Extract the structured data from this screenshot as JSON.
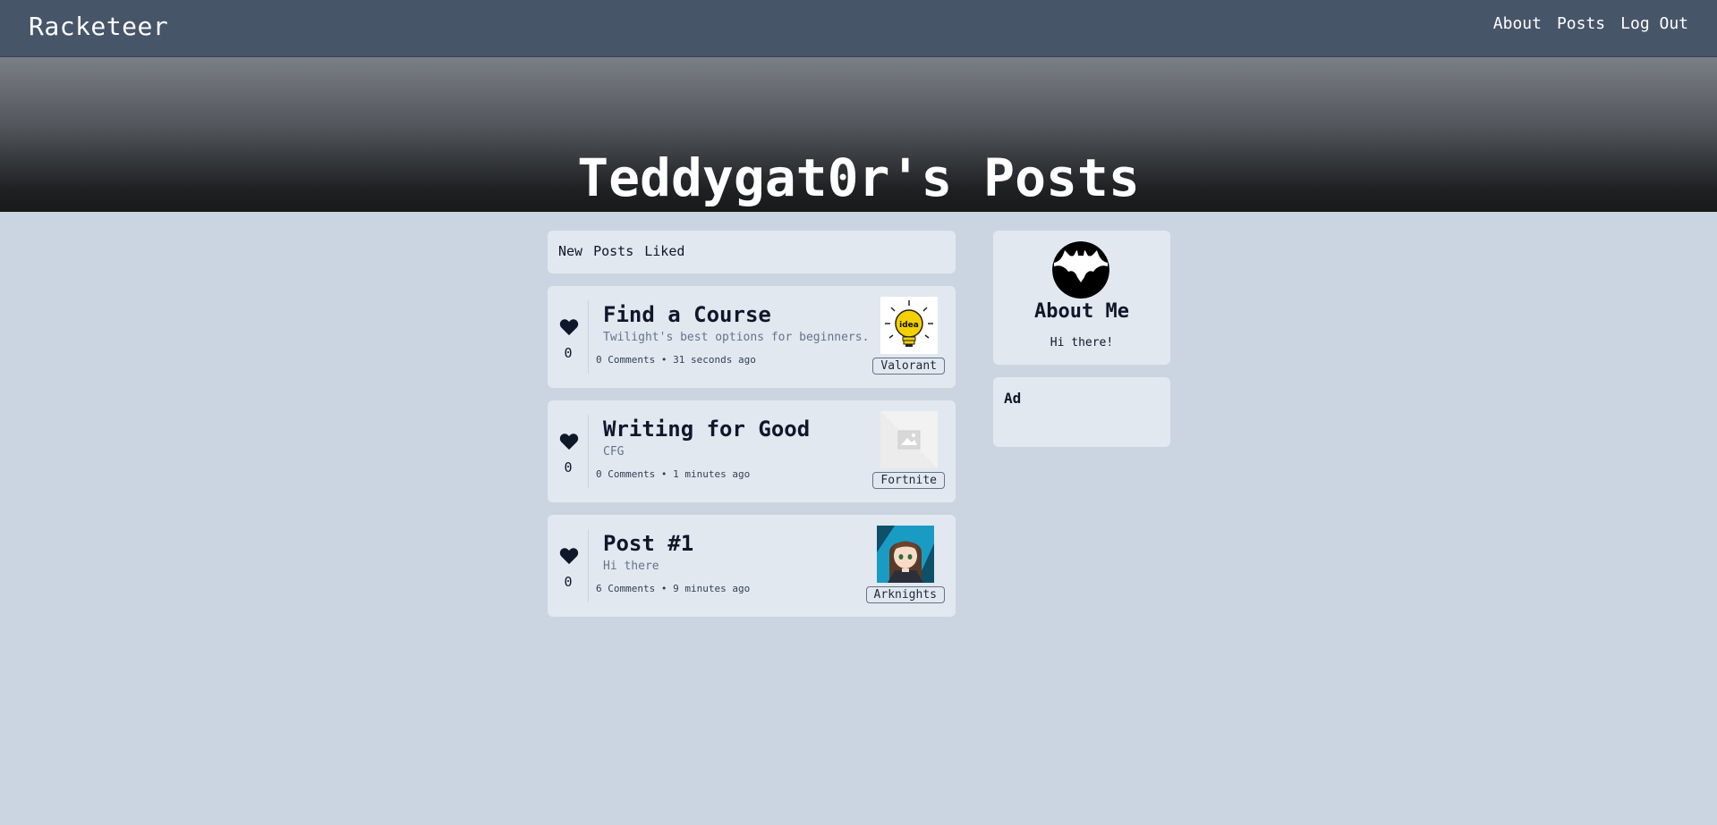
{
  "nav": {
    "brand": "Racketeer",
    "links": [
      "About",
      "Posts",
      "Log Out"
    ]
  },
  "hero": {
    "title": "Teddygat0r's Posts"
  },
  "filters": [
    "New",
    "Posts",
    "Liked"
  ],
  "posts": [
    {
      "likes": "0",
      "title": "Find a Course",
      "description": "Twilight's best options for beginners.",
      "comments": "0 Comments",
      "time": "31 seconds ago",
      "tag": "Valorant",
      "thumb_icon": "idea-lightbulb-image"
    },
    {
      "likes": "0",
      "title": "Writing for Good",
      "description": "CFG",
      "comments": "0 Comments",
      "time": "1 minutes ago",
      "tag": "Fortnite",
      "thumb_icon": "image-placeholder"
    },
    {
      "likes": "0",
      "title": "Post #1",
      "description": "Hi there",
      "comments": "6 Comments",
      "time": "9 minutes ago",
      "tag": "Arknights",
      "thumb_icon": "anime-character-image"
    }
  ],
  "about": {
    "title": "About Me",
    "text": "Hi there!",
    "avatar_icon": "bat-logo-avatar"
  },
  "ad": {
    "label": "Ad"
  },
  "colors": {
    "page_bg": "#cbd5e1",
    "nav_bg": "#475569",
    "card_bg": "#e2e8f0",
    "heart": "#0f172a"
  }
}
